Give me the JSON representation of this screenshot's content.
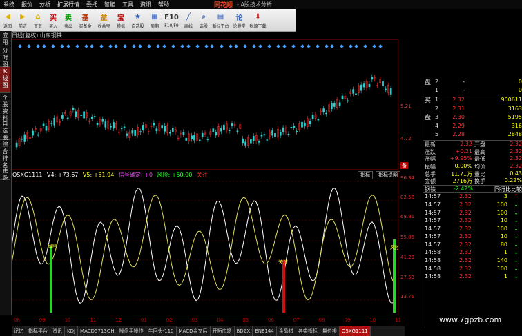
{
  "menu": [
    "系统",
    "报价",
    "分析",
    "扩展行情",
    "委托",
    "智能",
    "工具",
    "资讯",
    "帮助"
  ],
  "brand": "同花顺",
  "brand_sub": "- A股技术分析",
  "toolbar": [
    {
      "label": "返回",
      "icon": "back",
      "color": "#e0b000"
    },
    {
      "label": "前进",
      "icon": "forward",
      "color": "#e0b000"
    },
    {
      "label": "首页",
      "icon": "home",
      "color": "#e0b000"
    },
    {
      "label": "买入",
      "icon": "buy",
      "color": "#d00000"
    },
    {
      "label": "卖出",
      "icon": "sell",
      "color": "#00a000"
    },
    {
      "label": "买基金",
      "icon": "fund",
      "color": "#c03000"
    },
    {
      "label": "收益宝",
      "icon": "yield",
      "color": "#d08000"
    },
    {
      "label": "模拟",
      "icon": "sim",
      "color": "#c00000"
    },
    {
      "label": "自选股",
      "icon": "watchlist",
      "color": "#3060c0"
    },
    {
      "label": "周期",
      "icon": "period",
      "color": "#3060c0"
    },
    {
      "label": "F10/F9",
      "icon": "f10",
      "color": "#303030"
    },
    {
      "label": "画线",
      "icon": "draw",
      "color": "#3060c0"
    },
    {
      "label": "选股",
      "icon": "screen",
      "color": "#3060c0"
    },
    {
      "label": "新标平台",
      "icon": "platform",
      "color": "#3060c0"
    },
    {
      "label": "论股堂",
      "icon": "forum",
      "color": "#3060c0"
    },
    {
      "label": "税源下载",
      "icon": "download",
      "color": "#c00000"
    }
  ],
  "sidebar": [
    "应用",
    "分时图",
    "K线图",
    "个股资料",
    "自选股",
    "综合排名",
    "更多"
  ],
  "stock_title": "日线(复权) 山东钢铁",
  "indicator": {
    "name": "QSXG1111",
    "v4": "V4: +73.67",
    "v5": "V5: +51.94",
    "signal": "信号确定: +0",
    "risk": "风险: +50.00",
    "note": "关注",
    "btn1": "指标",
    "btn2": "指标说明",
    "marker_left": "风险",
    "marker_mid": "关注",
    "marker_right": "风险"
  },
  "price_axis": {
    "upper": [
      "5.21",
      "4.72"
    ],
    "lower": [
      "96.34",
      "82.58",
      "68.81",
      "55.05",
      "41.29",
      "27.53",
      "13.76"
    ],
    "marker": "备"
  },
  "dates": [
    "08",
    "09",
    "10",
    "11",
    "12",
    "01",
    "02",
    "03",
    "04",
    "05",
    "06",
    "07",
    "08",
    "09",
    "10",
    "11"
  ],
  "bottom_tabs": [
    "记忆",
    "指标平台",
    "资讯",
    "KDJ",
    "MACD5713QH",
    "操盘手操作",
    "牛回头-110",
    "MACD金叉后",
    "开拓市场",
    "BDZX",
    "ENE144",
    "金晶猎",
    "各类指标",
    "量价排",
    "QSXG1111"
  ],
  "order_book": {
    "sell_label": "卖盘",
    "buy_label": "买盘",
    "asks": [
      {
        "level": "2",
        "price": "-",
        "vol": "0"
      },
      {
        "level": "1",
        "price": "-",
        "vol": "0"
      }
    ],
    "bids": [
      {
        "level": "1",
        "price": "2.32",
        "vol": "900611"
      },
      {
        "level": "2",
        "price": "2.31",
        "vol": "3163"
      },
      {
        "level": "3",
        "price": "2.30",
        "vol": "5195"
      },
      {
        "level": "4",
        "price": "2.29",
        "vol": "316"
      },
      {
        "level": "5",
        "price": "2.28",
        "vol": "2848"
      }
    ]
  },
  "stats": [
    {
      "l": "最新",
      "v": "2.32",
      "l2": "开盘",
      "v2": "2.32"
    },
    {
      "l": "涨跌",
      "v": "+0.21",
      "l2": "最高",
      "v2": "2.32"
    },
    {
      "l": "涨幅",
      "v": "+9.95%",
      "l2": "最低",
      "v2": "2.32"
    },
    {
      "l": "振幅",
      "v": "0.00%",
      "l2": "均价",
      "v2": "2.32"
    },
    {
      "l": "总手",
      "v": "11.71万",
      "l2": "量比",
      "v2": "0.43"
    },
    {
      "l": "金额",
      "v": "2716万",
      "l2": "换手",
      "v2": "0.22%"
    }
  ],
  "sector": {
    "name": "钢铁",
    "change": "-2.42%",
    "compare": "同行比比较"
  },
  "trades": [
    {
      "time": "14:57",
      "price": "2.32",
      "vol": "3",
      "dir": "up"
    },
    {
      "time": "14:57",
      "price": "2.32",
      "vol": "100",
      "dir": "down"
    },
    {
      "time": "14:57",
      "price": "2.32",
      "vol": "100",
      "dir": "down"
    },
    {
      "time": "14:57",
      "price": "2.32",
      "vol": "10",
      "dir": "down"
    },
    {
      "time": "14:57",
      "price": "2.32",
      "vol": "100",
      "dir": "down"
    },
    {
      "time": "14:57",
      "price": "2.32",
      "vol": "10",
      "dir": "down"
    },
    {
      "time": "14:57",
      "price": "2.32",
      "vol": "80",
      "dir": "down"
    },
    {
      "time": "14:58",
      "price": "2.32",
      "vol": "1",
      "dir": "down"
    },
    {
      "time": "14:58",
      "price": "2.32",
      "vol": "140",
      "dir": "down"
    },
    {
      "time": "14:58",
      "price": "2.32",
      "vol": "100",
      "dir": "down"
    },
    {
      "time": "14:58",
      "price": "2.32",
      "vol": "1",
      "dir": "down"
    }
  ],
  "watermark": "www.7gpzb.com"
}
